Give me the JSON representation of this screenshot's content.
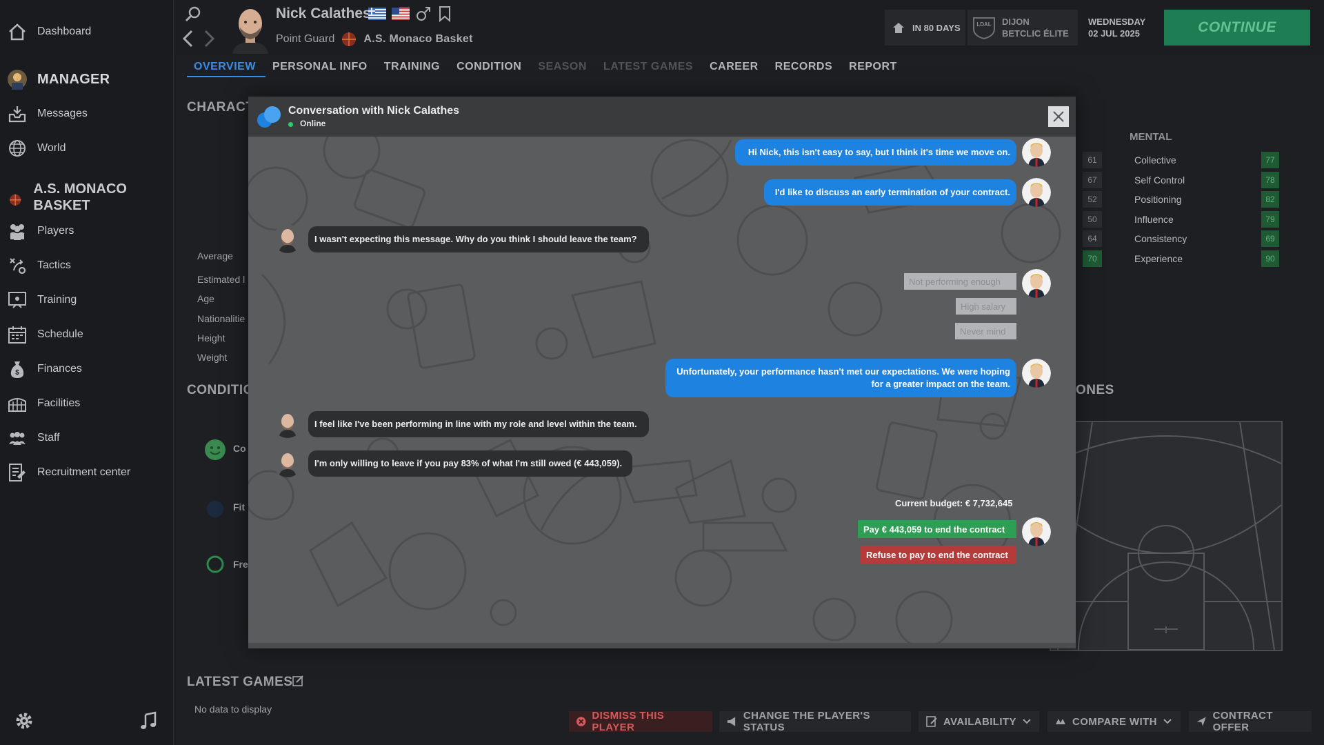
{
  "sidebar": {
    "dashboard": "Dashboard",
    "manager_section": "MANAGER",
    "messages": "Messages",
    "world": "World",
    "club_name": "A.S. MONACO BASKET",
    "players": "Players",
    "tactics": "Tactics",
    "training": "Training",
    "schedule": "Schedule",
    "finances": "Finances",
    "facilities": "Facilities",
    "staff": "Staff",
    "recruitment": "Recruitment center"
  },
  "header": {
    "player_name": "Nick Calathes",
    "position": "Point Guard",
    "club": "A.S. Monaco Basket",
    "next_game": "IN 80 DAYS",
    "opponent": "DIJON",
    "competition": "BETCLIC ÉLITE",
    "comp_logo_text": "LDAL",
    "weekday": "WEDNESDAY",
    "date": "02 JUL 2025",
    "continue": "CONTINUE"
  },
  "tabs": [
    "OVERVIEW",
    "PERSONAL INFO",
    "TRAINING",
    "CONDITION",
    "SEASON",
    "LATEST GAMES",
    "CAREER",
    "RECORDS",
    "REPORT"
  ],
  "background": {
    "characteristics_title": "CHARACT",
    "average": "Average",
    "estimated": "Estimated l",
    "age": "Age",
    "nationalities": "Nationalitie",
    "height": "Height",
    "weight": "Weight",
    "condition_title": "CONDITIO",
    "cond1": "Co",
    "cond2": "Fit",
    "cond3": "Fre",
    "mental_title": "MENTAL",
    "mental": [
      {
        "label": "Collective",
        "value": "77"
      },
      {
        "label": "Self Control",
        "value": "78"
      },
      {
        "label": "Positioning",
        "value": "82"
      },
      {
        "label": "Influence",
        "value": "79"
      },
      {
        "label": "Consistency",
        "value": "69"
      },
      {
        "label": "Experience",
        "value": "90"
      }
    ],
    "left_values": [
      "61",
      "67",
      "52",
      "50",
      "64",
      "70"
    ],
    "zones_title": "ONES",
    "latest_games_title": "LATEST GAMES",
    "no_data": "No data to display"
  },
  "actions": {
    "dismiss": "DISMISS THIS PLAYER",
    "change_status": "CHANGE THE PLAYER'S STATUS",
    "availability": "AVAILABILITY",
    "compare": "COMPARE WITH",
    "contract": "CONTRACT OFFER"
  },
  "dialog": {
    "title": "Conversation with Nick Calathes",
    "status": "Online",
    "messages": {
      "m1": "Hi Nick, this isn't easy to say, but I think it's time we move on.",
      "m2": "I'd like to discuss an early termination of your contract.",
      "m3": "I wasn't expecting this message. Why do you think I should leave the team?",
      "m4": "Unfortunately, your performance hasn't met our expectations. We were hoping for a greater impact on the team.",
      "m5": "I feel like I've been performing in line with my role and level within the team.",
      "m6": "I'm only willing to leave if you pay 83% of what I'm still owed (€ 443,059)."
    },
    "options": [
      "Not performing enough",
      "High salary",
      "Never mind"
    ],
    "budget": "Current budget: € 7,732,645",
    "pay": "Pay € 443,059 to end the contract",
    "refuse": "Refuse to pay to end the contract"
  },
  "colors": {
    "accent": "#3b8ce8",
    "continue": "#1e7d52",
    "user_bubble": "#1e82e0",
    "player_bubble": "#2d2e30",
    "pay": "#2e9e55",
    "refuse": "#b53a3a"
  }
}
